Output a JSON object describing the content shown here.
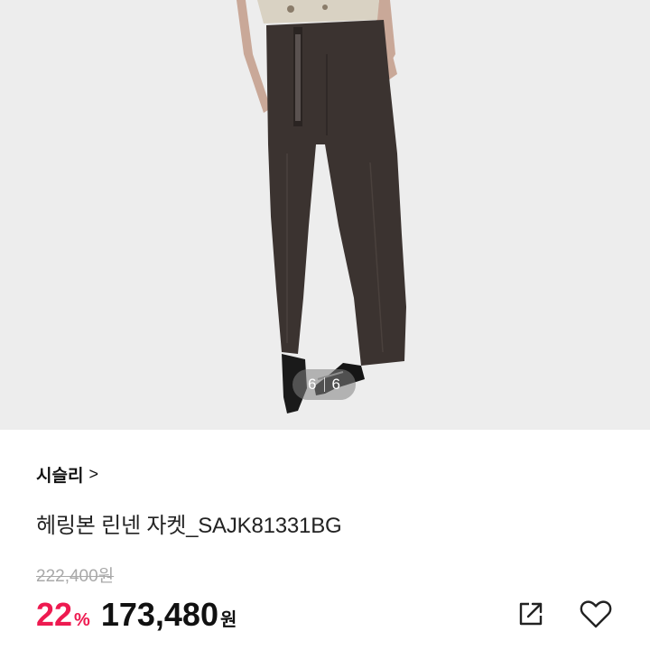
{
  "image": {
    "counter_current": "6",
    "counter_total": "6"
  },
  "product": {
    "brand": "시슬리",
    "brand_chevron": ">",
    "title": "헤링본 린넨 자켓_SAJK81331BG",
    "original_price": "222,400원",
    "discount": "22",
    "discount_unit": "%",
    "price": "173,480",
    "currency": "원"
  },
  "actions": {
    "share_icon": "share-icon",
    "like_icon": "heart-icon"
  },
  "colors": {
    "discount": "#ee1a50",
    "background_photo": "#ededed"
  }
}
